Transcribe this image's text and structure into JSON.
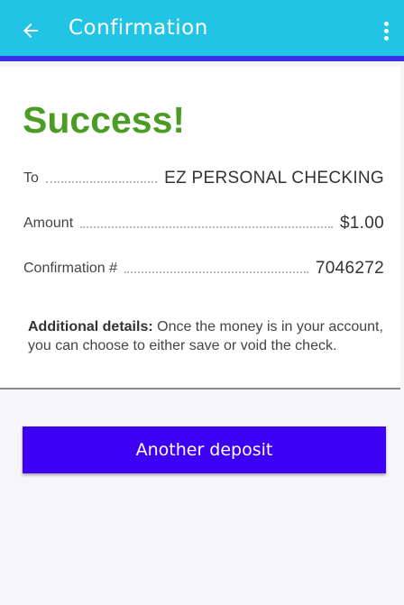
{
  "appbar": {
    "title": "Confirmation",
    "back_icon": "arrow-left-icon",
    "overflow_icon": "more-vertical-icon",
    "color": "#22c4e6",
    "accent_border": "#3a2fe6"
  },
  "result": {
    "heading": "Success!",
    "heading_color": "#4a9c23"
  },
  "rows": [
    {
      "label": "To",
      "value": "EZ PERSONAL CHECKING"
    },
    {
      "label": "Amount",
      "value": "$1.00"
    },
    {
      "label": "Confirmation #",
      "value": "7046272"
    }
  ],
  "details": {
    "label": "Additional details:",
    "text": " Once the money is in your account, you can choose to either save or void the check."
  },
  "actions": {
    "another_deposit_label": "Another deposit",
    "button_color": "#3d00f5"
  }
}
